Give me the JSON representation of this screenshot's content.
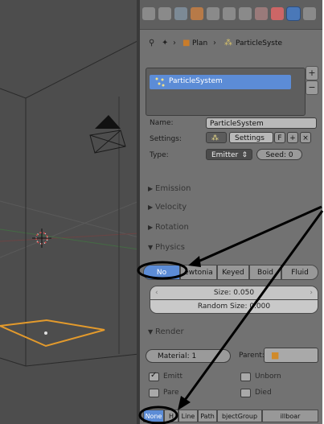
{
  "panel": {
    "breadcrumb": {
      "object": "Plan",
      "system": "ParticleSyste"
    },
    "list": {
      "item": "ParticleSystem",
      "add_label": "+",
      "remove_label": "−"
    },
    "name_label": "Name:",
    "name_value": "ParticleSystem",
    "settings_label": "Settings:",
    "settings_value": "Settings",
    "settings_f": "F",
    "type_label": "Type:",
    "type_value": "Emitter",
    "seed_value": "Seed: 0",
    "sections": {
      "emission": "Emission",
      "velocity": "Velocity",
      "rotation": "Rotation",
      "physics": "Physics",
      "render": "Render"
    },
    "physics": {
      "types": [
        "No",
        "ewtonia",
        "Keyed",
        "Boid",
        "Fluid"
      ],
      "selected": "No",
      "size": "Size: 0.050",
      "random_size": "Random Size: 0.000"
    },
    "render": {
      "material": "Material: 1",
      "parent_label": "Parent:",
      "emitter_label": "Emitt",
      "unborn_label": "Unborn",
      "parents_label": "Pare",
      "died_label": "Died",
      "types": [
        "None",
        "H",
        "Line",
        "Path",
        "bjectGroup",
        "illboar"
      ],
      "selected": "None"
    }
  },
  "colors": {
    "selection": "#5c8cd6",
    "annotation": "#000000",
    "orange_outline": "#e39a2c"
  }
}
